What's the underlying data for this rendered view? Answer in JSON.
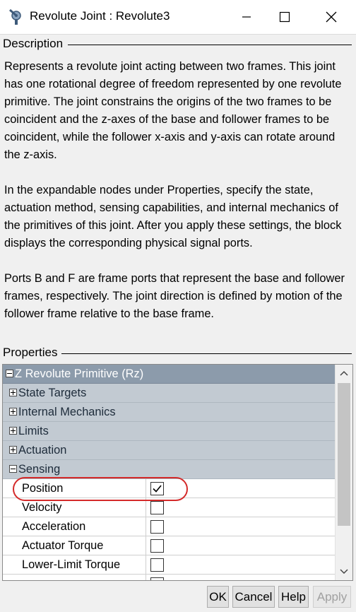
{
  "window": {
    "title": "Revolute Joint : Revolute3",
    "icon": "simscape-block-icon"
  },
  "description": {
    "label": "Description",
    "paragraphs": [
      "Represents a revolute joint acting between two frames. This joint has one rotational degree of freedom represented by one revolute primitive. The joint constrains the origins of the two frames to be coincident and the z-axes of the base and follower frames to be coincident, while the follower x-axis and y-axis can rotate around the z-axis.",
      "In the expandable nodes under Properties, specify the state, actuation method, sensing capabilities, and internal mechanics of the primitives of this joint. After you apply these settings, the block displays the corresponding physical signal ports.",
      "Ports B and F are frame ports that represent the base and follower frames, respectively. The joint direction is defined by motion of the follower frame relative to the base frame."
    ]
  },
  "properties": {
    "label": "Properties",
    "primitive": {
      "label": "Z Revolute Primitive (Rz)",
      "expanded": true
    },
    "groups": [
      {
        "label": "State Targets",
        "expanded": false
      },
      {
        "label": "Internal Mechanics",
        "expanded": false
      },
      {
        "label": "Limits",
        "expanded": false
      },
      {
        "label": "Actuation",
        "expanded": false
      },
      {
        "label": "Sensing",
        "expanded": true
      }
    ],
    "sensing_items": [
      {
        "label": "Position",
        "checked": true
      },
      {
        "label": "Velocity",
        "checked": false
      },
      {
        "label": "Acceleration",
        "checked": false
      },
      {
        "label": "Actuator Torque",
        "checked": false
      },
      {
        "label": "Lower-Limit Torque",
        "checked": false
      }
    ]
  },
  "buttons": {
    "ok": "OK",
    "cancel": "Cancel",
    "help": "Help",
    "apply": "Apply"
  },
  "colors": {
    "primitive_header": "#8c9bab",
    "group_row": "#c2cad2",
    "highlight": "#d42a2a"
  }
}
